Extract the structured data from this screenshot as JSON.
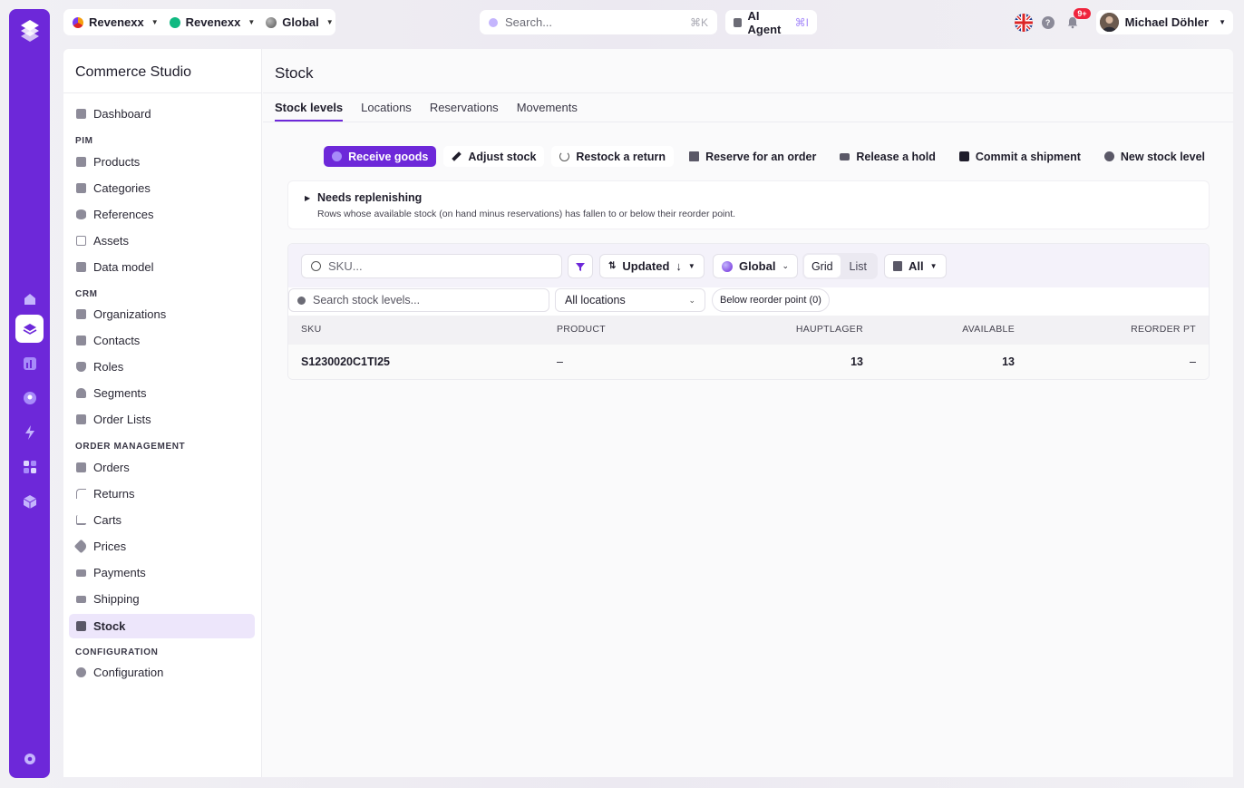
{
  "topbar": {
    "org_1": "Revenexx",
    "org_2": "Revenexx",
    "scope": "Global",
    "search_placeholder": "Search...",
    "search_shortcut": "⌘K",
    "ai_label": "AI Agent",
    "ai_shortcut": "⌘I",
    "notification_count": "9+",
    "user_name": "Michael Döhler"
  },
  "sidebar": {
    "title": "Commerce Studio",
    "top_items": [
      {
        "label": "Dashboard",
        "icon": "dashboard-icon"
      }
    ],
    "sections": [
      {
        "title": "PIM",
        "items": [
          {
            "label": "Products",
            "icon": "cube-icon"
          },
          {
            "label": "Categories",
            "icon": "cube-icon"
          },
          {
            "label": "References",
            "icon": "database-icon"
          },
          {
            "label": "Assets",
            "icon": "image-icon"
          },
          {
            "label": "Data model",
            "icon": "grid-icon"
          }
        ]
      },
      {
        "title": "CRM",
        "items": [
          {
            "label": "Organizations",
            "icon": "cube-icon"
          },
          {
            "label": "Contacts",
            "icon": "cube-icon"
          },
          {
            "label": "Roles",
            "icon": "shield-icon"
          },
          {
            "label": "Segments",
            "icon": "users-icon"
          },
          {
            "label": "Order Lists",
            "icon": "bookmark-icon"
          }
        ]
      },
      {
        "title": "ORDER MANAGEMENT",
        "items": [
          {
            "label": "Orders",
            "icon": "cube-icon"
          },
          {
            "label": "Returns",
            "icon": "return-icon"
          },
          {
            "label": "Carts",
            "icon": "cart-icon"
          },
          {
            "label": "Prices",
            "icon": "tag-icon"
          },
          {
            "label": "Payments",
            "icon": "card-icon"
          },
          {
            "label": "Shipping",
            "icon": "truck-icon"
          },
          {
            "label": "Stock",
            "icon": "cube-icon"
          }
        ]
      },
      {
        "title": "CONFIGURATION",
        "items": [
          {
            "label": "Configuration",
            "icon": "gear-icon"
          }
        ]
      }
    ],
    "active": "Stock"
  },
  "page": {
    "title": "Stock",
    "tabs": [
      "Stock levels",
      "Locations",
      "Reservations",
      "Movements"
    ],
    "active_tab": "Stock levels"
  },
  "actions": [
    {
      "label": "Receive goods",
      "icon": "plus-circle-icon"
    },
    {
      "label": "Adjust stock",
      "icon": "pencil-icon"
    },
    {
      "label": "Restock a return",
      "icon": "refresh-icon"
    },
    {
      "label": "Reserve for an order",
      "icon": "bookmark-icon"
    },
    {
      "label": "Release a hold",
      "icon": "x-box-icon"
    },
    {
      "label": "Commit a shipment",
      "icon": "box-icon"
    },
    {
      "label": "New stock level",
      "icon": "plus-circle-icon"
    }
  ],
  "replenish": {
    "title": "Needs replenishing",
    "description": "Rows whose available stock (on hand minus reservations) has fallen to or below their reorder point."
  },
  "toolbar": {
    "sku_placeholder": "SKU...",
    "sort_label": "Updated",
    "scope_label": "Global",
    "view_grid": "Grid",
    "view_list": "List",
    "view_active": "Grid",
    "type_label": "All",
    "search_levels_placeholder": "Search stock levels...",
    "locations_select": "All locations",
    "reorder_chip": "Below reorder point (0)"
  },
  "table": {
    "columns": [
      "SKU",
      "PRODUCT",
      "HAUPTLAGER",
      "AVAILABLE",
      "REORDER PT"
    ],
    "rows": [
      [
        "S1230020C1TI25",
        "–",
        "13",
        "13",
        "–"
      ]
    ]
  },
  "colors": {
    "brand": "#6d28d9",
    "active_bg": "#ede6fb",
    "badge": "#ef233c"
  }
}
